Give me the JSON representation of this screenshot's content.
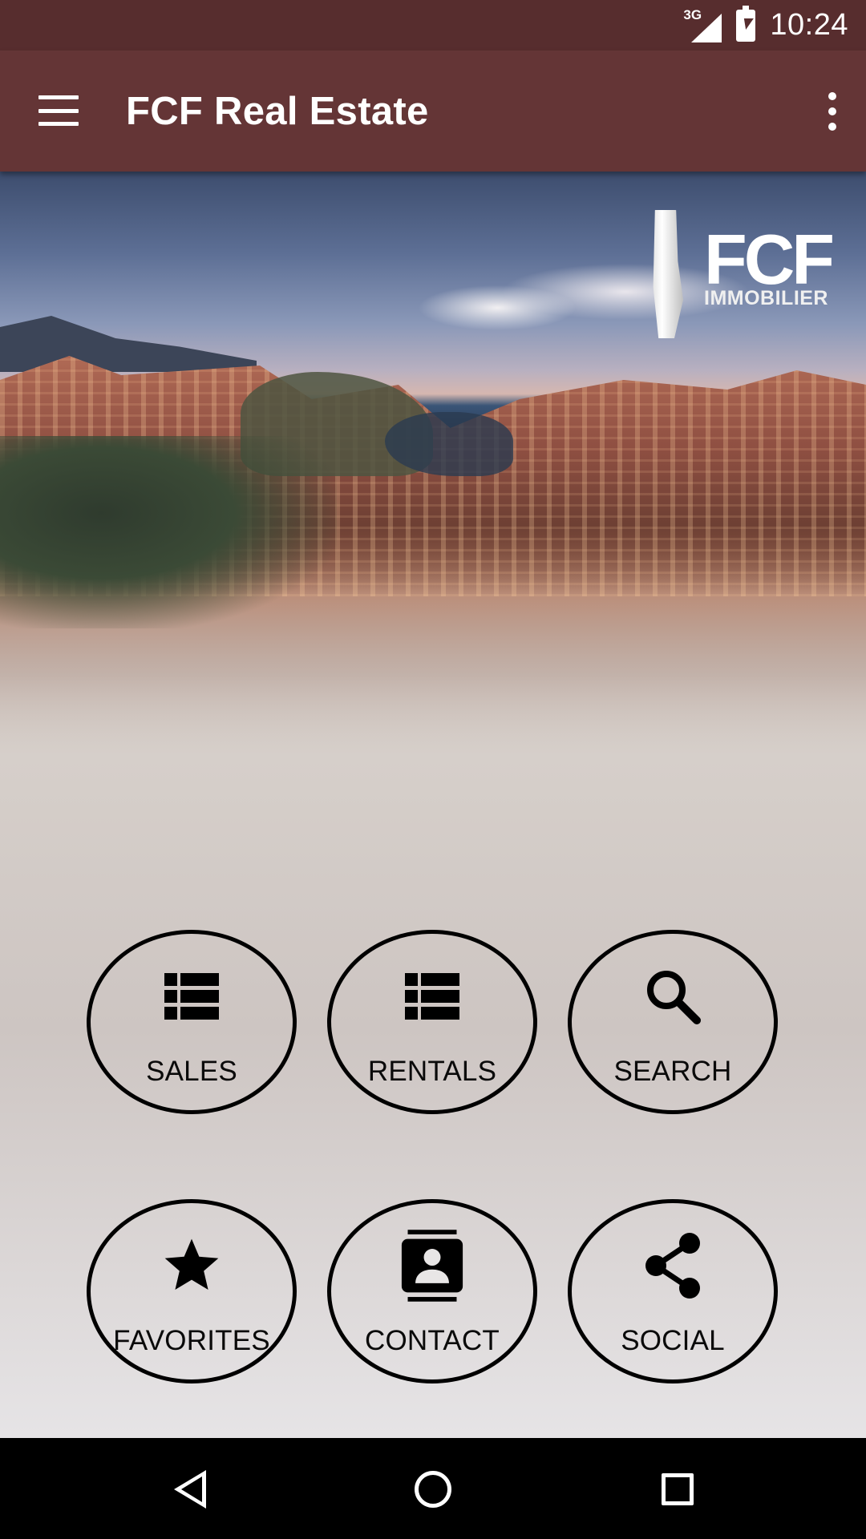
{
  "status_bar": {
    "network": "3G",
    "time": "10:24"
  },
  "app_bar": {
    "title": "FCF Real Estate"
  },
  "hero": {
    "logo_mark": "FCF",
    "logo_sub": "IMMOBILIER"
  },
  "tiles": [
    {
      "label": "SALES",
      "icon": "list-icon"
    },
    {
      "label": "RENTALS",
      "icon": "list-icon"
    },
    {
      "label": "SEARCH",
      "icon": "search-icon"
    },
    {
      "label": "FAVORITES",
      "icon": "star-icon"
    },
    {
      "label": "CONTACT",
      "icon": "contact-card-icon"
    },
    {
      "label": "SOCIAL",
      "icon": "share-icon"
    }
  ],
  "colors": {
    "status_bar": "#572d2e",
    "app_bar": "#643536",
    "nav_bar": "#000000"
  }
}
